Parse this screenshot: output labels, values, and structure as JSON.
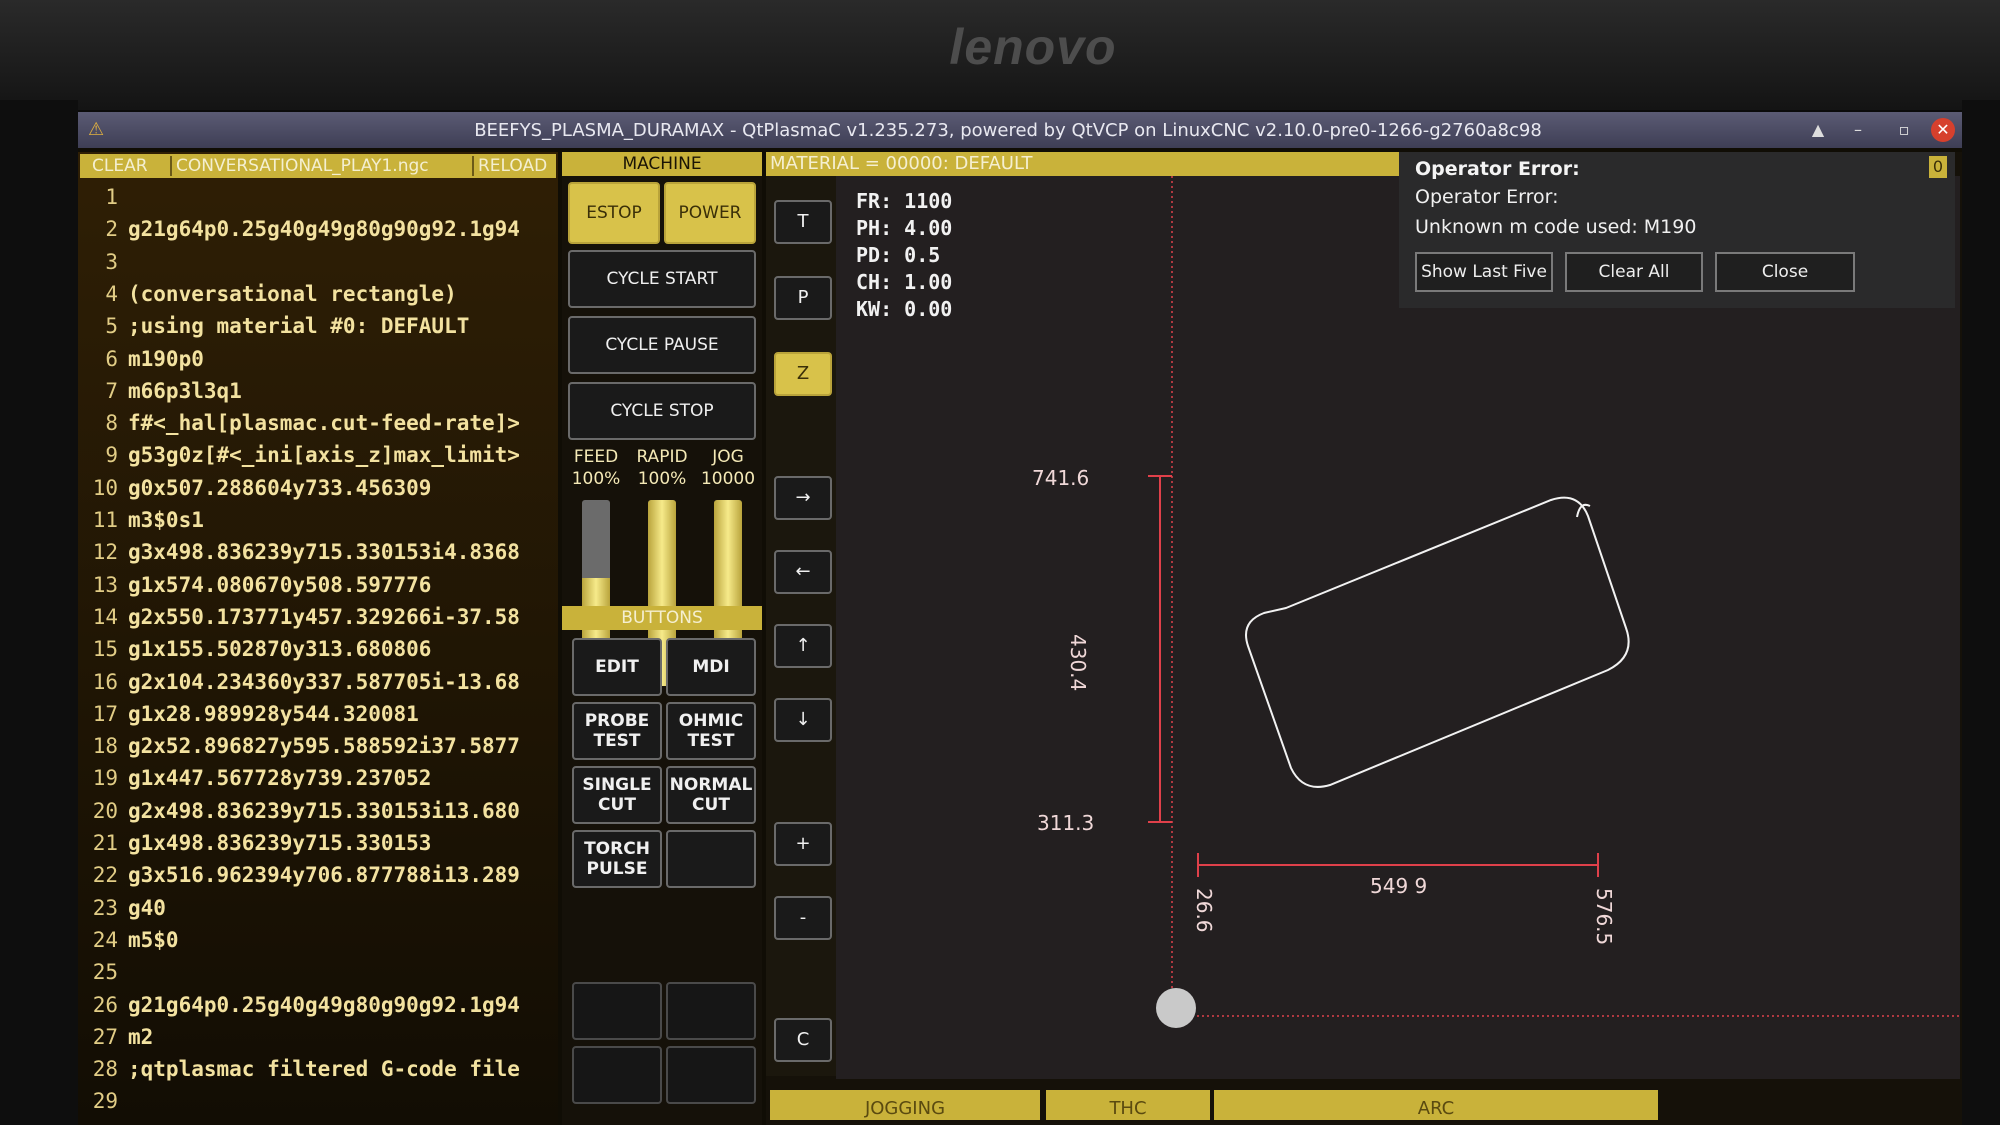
{
  "monitor": {
    "brand": "lenovo"
  },
  "window": {
    "title": "BEEFYS_PLASMA_DURAMAX - QtPlasmaC v1.235.273, powered by QtVCP on LinuxCNC v2.10.0-pre0-1266-g2760a8c98",
    "min_glyph": "▲",
    "minimize_glyph": "–",
    "restore_glyph": "▫",
    "close_glyph": "✕"
  },
  "gcode": {
    "toolbar": {
      "clear": "CLEAR",
      "file": "CONVERSATIONAL_PLAY1.ngc",
      "reload": "RELOAD"
    },
    "lines": [
      {
        "n": "1",
        "t": ""
      },
      {
        "n": "2",
        "t": "g21g64p0.25g40g49g80g90g92.1g94"
      },
      {
        "n": "3",
        "t": ""
      },
      {
        "n": "4",
        "t": "(conversational rectangle)"
      },
      {
        "n": "5",
        "t": ";using material #0: DEFAULT"
      },
      {
        "n": "6",
        "t": "m190p0"
      },
      {
        "n": "7",
        "t": "m66p3l3q1"
      },
      {
        "n": "8",
        "t": "f#<_hal[plasmac.cut-feed-rate]>"
      },
      {
        "n": "9",
        "t": "g53g0z[#<_ini[axis_z]max_limit>"
      },
      {
        "n": "10",
        "t": "g0x507.288604y733.456309"
      },
      {
        "n": "11",
        "t": "m3$0s1"
      },
      {
        "n": "12",
        "t": "g3x498.836239y715.330153i4.8368"
      },
      {
        "n": "13",
        "t": "g1x574.080670y508.597776"
      },
      {
        "n": "14",
        "t": "g2x550.173771y457.329266i-37.58"
      },
      {
        "n": "15",
        "t": "g1x155.502870y313.680806"
      },
      {
        "n": "16",
        "t": "g2x104.234360y337.587705i-13.68"
      },
      {
        "n": "17",
        "t": "g1x28.989928y544.320081"
      },
      {
        "n": "18",
        "t": "g2x52.896827y595.588592i37.5877"
      },
      {
        "n": "19",
        "t": "g1x447.567728y739.237052"
      },
      {
        "n": "20",
        "t": "g2x498.836239y715.330153i13.680"
      },
      {
        "n": "21",
        "t": "g1x498.836239y715.330153"
      },
      {
        "n": "22",
        "t": "g3x516.962394y706.877788i13.289"
      },
      {
        "n": "23",
        "t": "g40"
      },
      {
        "n": "24",
        "t": "m5$0"
      },
      {
        "n": "25",
        "t": ""
      },
      {
        "n": "26",
        "t": "g21g64p0.25g40g49g80g90g92.1g94"
      },
      {
        "n": "27",
        "t": "m2"
      },
      {
        "n": "28",
        "t": ";qtplasmac filtered G-code file"
      },
      {
        "n": "29",
        "t": ""
      }
    ]
  },
  "machine": {
    "header": "MACHINE",
    "estop": "ESTOP",
    "power": "POWER",
    "cycle_start": "CYCLE START",
    "cycle_pause": "CYCLE PAUSE",
    "cycle_stop": "CYCLE STOP",
    "overrides": [
      {
        "label": "FEED",
        "value": "100%",
        "level": 0.58
      },
      {
        "label": "RAPID",
        "value": "100%",
        "level": 1.0
      },
      {
        "label": "JOG",
        "value": "10000",
        "level": 1.0
      }
    ],
    "buttons_header": "BUTTONS",
    "buttons": [
      {
        "line1": "EDIT",
        "line2": ""
      },
      {
        "line1": "MDI",
        "line2": ""
      },
      {
        "line1": "PROBE",
        "line2": "TEST"
      },
      {
        "line1": "OHMIC",
        "line2": "TEST"
      },
      {
        "line1": "SINGLE",
        "line2": "CUT"
      },
      {
        "line1": "NORMAL",
        "line2": "CUT"
      },
      {
        "line1": "TORCH",
        "line2": "PULSE"
      },
      {
        "line1": "",
        "line2": ""
      }
    ]
  },
  "preview": {
    "material": "MATERIAL = 00000: DEFAULT",
    "view_buttons": [
      "T",
      "P",
      "Z"
    ],
    "jog_buttons": [
      "→",
      "←",
      "↑",
      "↓",
      "+",
      "-",
      "C"
    ],
    "dro": [
      {
        "label": "FR:",
        "value": "1100"
      },
      {
        "label": "PH:",
        "value": "4.00"
      },
      {
        "label": "PD:",
        "value": "0.5"
      },
      {
        "label": "CH:",
        "value": "1.00"
      },
      {
        "label": "KW:",
        "value": "0.00"
      }
    ],
    "dims": {
      "y_max": "741.6",
      "y_size": "430.4",
      "y_min": "311.3",
      "x_size": "549 9",
      "x_min": "26.6",
      "x_max": "576.5"
    },
    "colors": {
      "dimension": "#e0404a",
      "path": "#f2f2f2"
    }
  },
  "bottom_tabs": [
    "JOGGING",
    "THC",
    "ARC"
  ],
  "error": {
    "title": "Operator Error:",
    "line1": "Operator Error:",
    "line2": "Unknown m code used: M190",
    "show_last_five": "Show Last Five",
    "clear_all": "Clear All",
    "close": "Close",
    "count": "0"
  },
  "colors": {
    "accent": "#c9b23a",
    "gcode_text": "#f3e2a0",
    "button_yellow": "#d8c24a"
  }
}
